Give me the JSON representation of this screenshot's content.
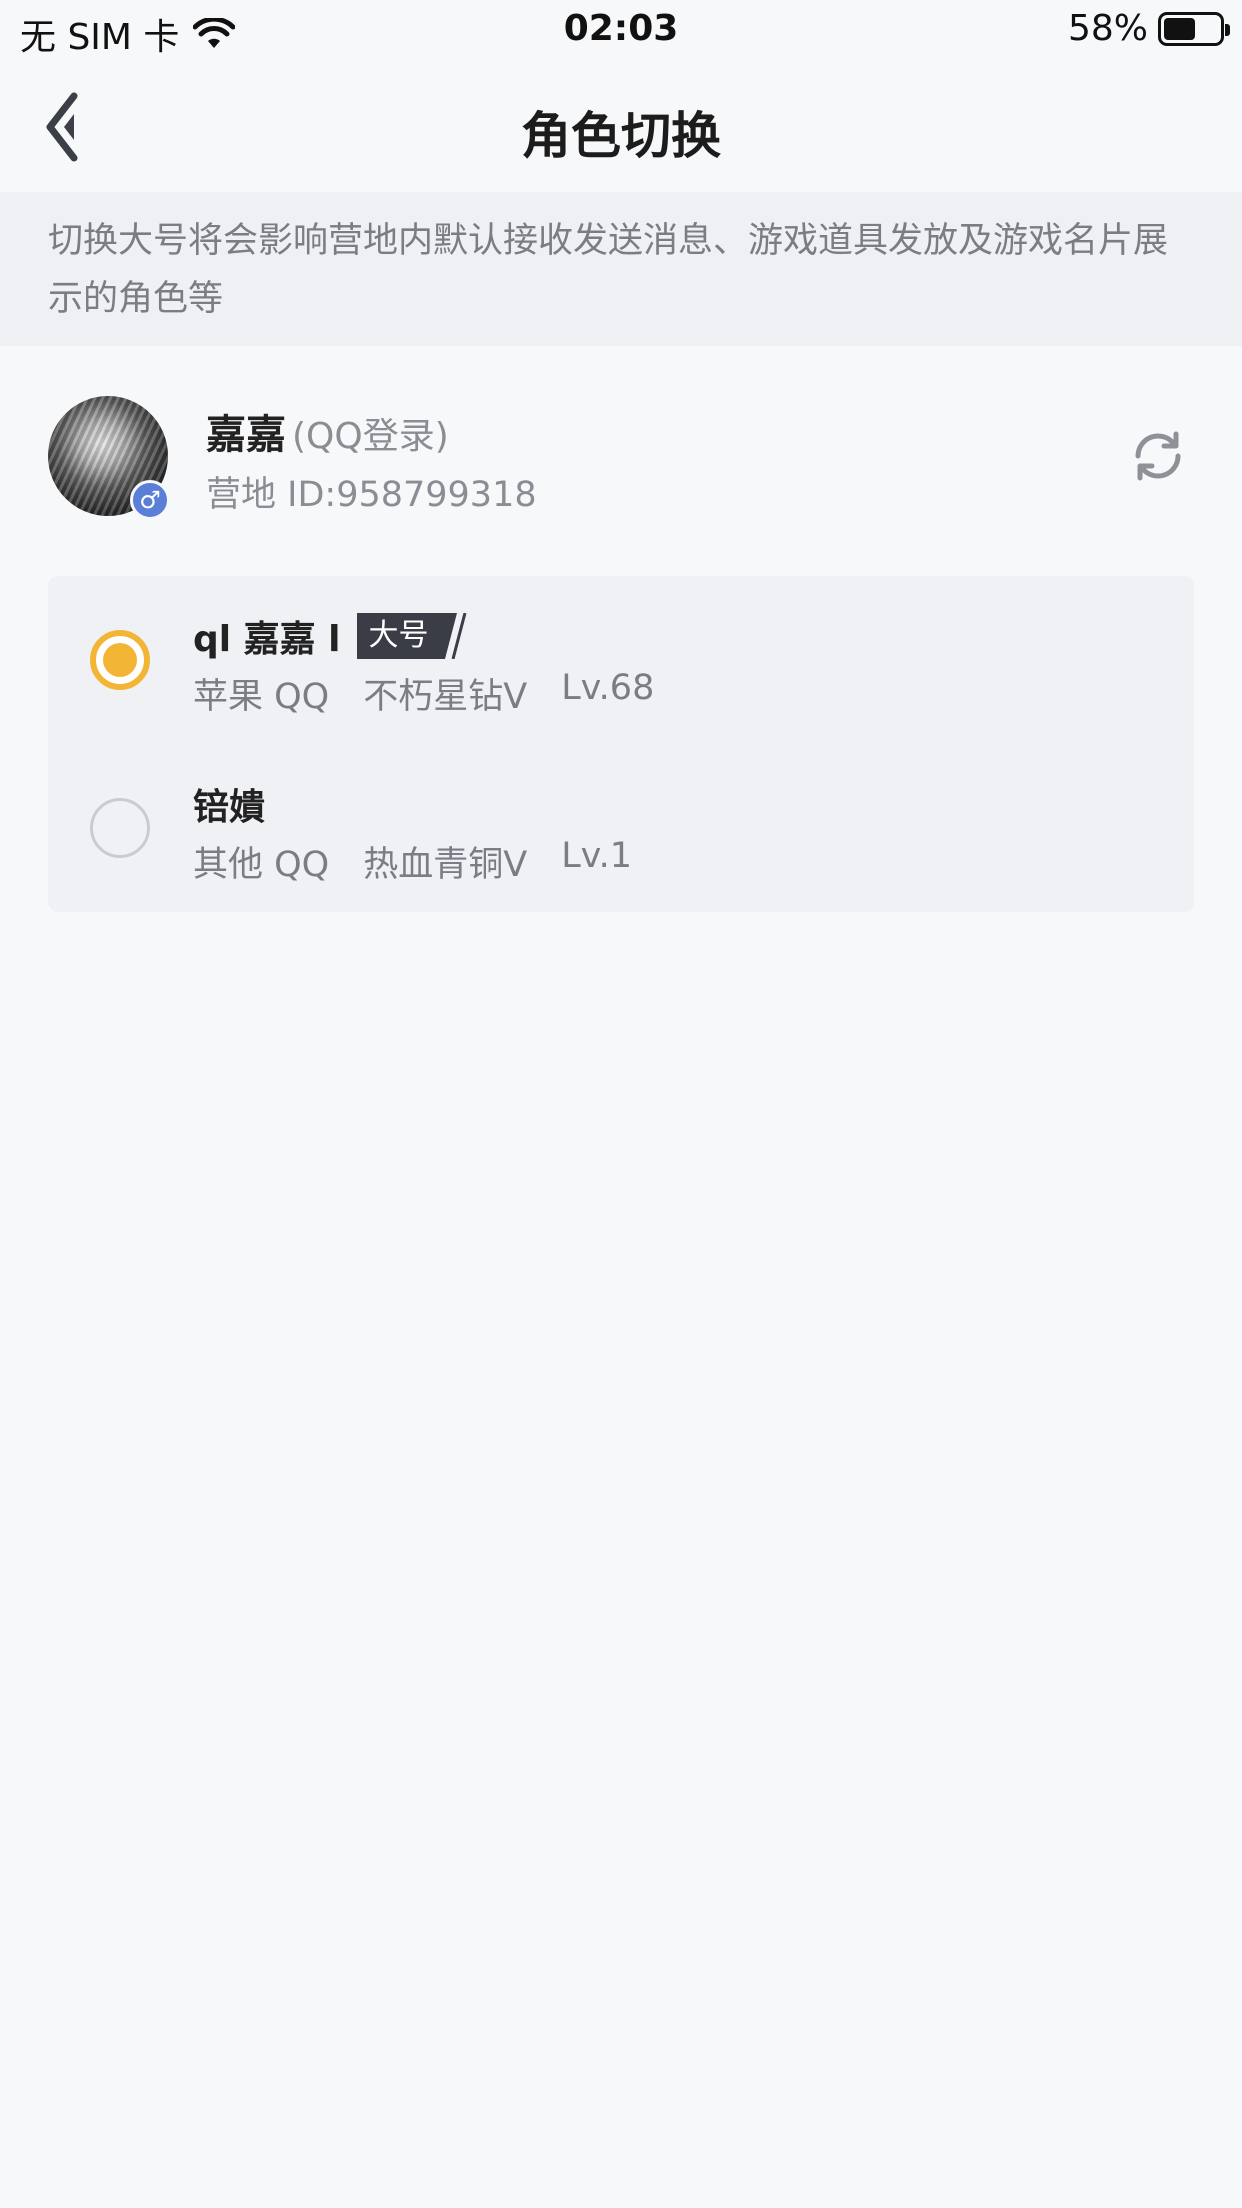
{
  "status_bar": {
    "carrier": "无 SIM 卡",
    "time": "02:03",
    "battery_percent": "58%",
    "battery_level": 0.58
  },
  "nav": {
    "title": "角色切换",
    "back_icon": "chevron-left-icon"
  },
  "notice": {
    "text": "切换大号将会影响营地内默认接收发送消息、游戏道具发放及游戏名片展示的角色等"
  },
  "profile": {
    "name": "嘉嘉",
    "login_type": "(QQ登录)",
    "id_text": "营地 ID:958799318",
    "gender_symbol": "♂",
    "refresh_icon": "refresh-icon"
  },
  "roles": [
    {
      "name": "ql 嘉嘉 l",
      "tag": "大号",
      "platform": "苹果 QQ",
      "rank": "不朽星钻Ⅴ",
      "level": "Lv.68",
      "selected": true
    },
    {
      "name": "锫嬇",
      "tag": "",
      "platform": "其他 QQ",
      "rank": "热血青铜Ⅴ",
      "level": "Lv.1",
      "selected": false
    }
  ],
  "colors": {
    "accent": "#f2b535",
    "background": "#f7f8fa",
    "card": "#eff1f4",
    "tag_bg": "#3a3d46",
    "gender_badge": "#5b7fd6"
  }
}
